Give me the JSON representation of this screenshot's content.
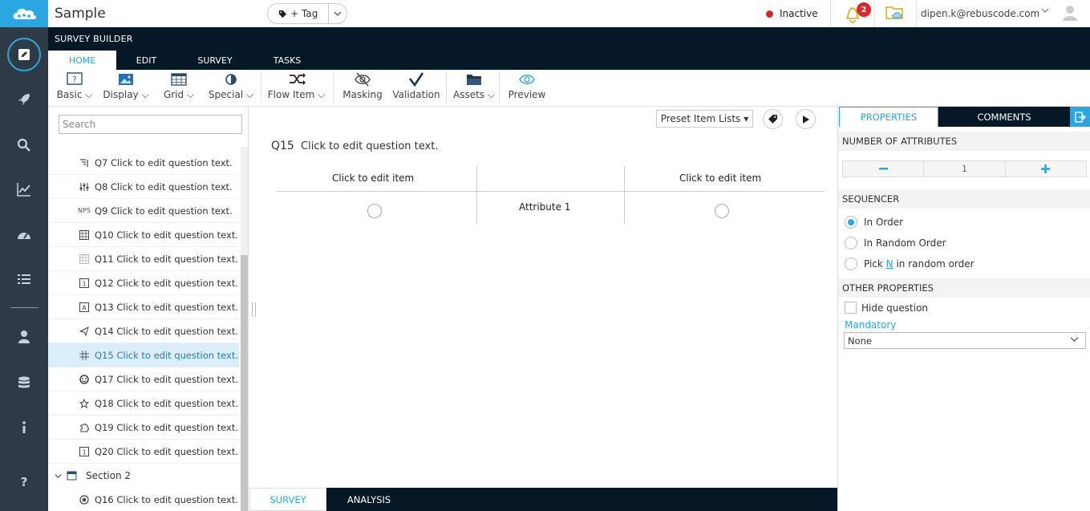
{
  "app": {
    "title": "Sample"
  },
  "topbar": {
    "tag_label": "+ Tag",
    "status": "Inactive",
    "status_color": "#d9232f",
    "notifications_count": "2",
    "user_email": "dipen.k@rebuscode.com"
  },
  "builder": {
    "title": "SURVEY BUILDER",
    "tabs": [
      "HOME",
      "EDIT",
      "SURVEY",
      "TASKS"
    ],
    "active_tab": "HOME"
  },
  "ribbon": {
    "basic": "Basic",
    "display": "Display",
    "grid": "Grid",
    "special": "Special",
    "flow_item": "Flow Item",
    "masking": "Masking",
    "validation": "Validation",
    "assets": "Assets",
    "preview": "Preview"
  },
  "sidebar": {
    "search_placeholder": "Search",
    "questions": [
      {
        "id": "Q7",
        "text": "Q7 Click to edit question text.",
        "icon": "ranking-icon"
      },
      {
        "id": "Q8",
        "text": "Q8 Click to edit question text.",
        "icon": "slider-icon"
      },
      {
        "id": "Q9",
        "text": "Q9 Click to edit question text.",
        "icon": "nps-icon",
        "icon_text": "NPS"
      },
      {
        "id": "Q10",
        "text": "Q10 Click to edit question text.",
        "icon": "grid-icon"
      },
      {
        "id": "Q11",
        "text": "Q11 Click to edit question text.",
        "icon": "grid-dotted-icon"
      },
      {
        "id": "Q12",
        "text": "Q12 Click to edit question text.",
        "icon": "numeric-grid-icon"
      },
      {
        "id": "Q13",
        "text": "Q13 Click to edit question text.",
        "icon": "text-grid-icon"
      },
      {
        "id": "Q14",
        "text": "Q14 Click to edit question text.",
        "icon": "send-icon"
      },
      {
        "id": "Q15",
        "text": "Q15 Click to edit question text.",
        "icon": "hash-grid-icon",
        "active": true
      },
      {
        "id": "Q17",
        "text": "Q17 Click to edit question text.",
        "icon": "smiley-icon"
      },
      {
        "id": "Q18",
        "text": "Q18 Click to edit question text.",
        "icon": "star-icon"
      },
      {
        "id": "Q19",
        "text": "Q19 Click to edit question text.",
        "icon": "puzzle-icon"
      },
      {
        "id": "Q20",
        "text": "Q20 Click to edit question text.",
        "icon": "numeric-grid-icon"
      }
    ],
    "section": "Section 2",
    "section_questions": [
      {
        "id": "Q16",
        "text": "Q16 Click to edit question text.",
        "icon": "radio-icon"
      }
    ]
  },
  "main": {
    "preset_label": "Preset Item Lists",
    "question_number": "Q15",
    "question_text": "Click to edit question text.",
    "left_item": "Click to edit item",
    "right_item": "Click to edit item",
    "attribute": "Attribute 1"
  },
  "bottom_tabs": {
    "survey": "SURVEY",
    "analysis": "ANALYSIS"
  },
  "properties": {
    "tab_properties": "PROPERTIES",
    "tab_comments": "COMMENTS",
    "number_of_attributes_label": "NUMBER OF ATTRIBUTES",
    "number_of_attributes": "1",
    "sequencer_label": "SEQUENCER",
    "seq_in_order": "In Order",
    "seq_random": "In Random Order",
    "seq_pick_prefix": "Pick ",
    "seq_pick_n": "N",
    "seq_pick_suffix": " in random order",
    "other_label": "OTHER PROPERTIES",
    "hide_question": "Hide question",
    "mandatory_label": "Mandatory",
    "mandatory_value": "None"
  },
  "colors": {
    "accent": "#2aa7e0",
    "dark": "#061826",
    "nav": "#2e3b47"
  }
}
